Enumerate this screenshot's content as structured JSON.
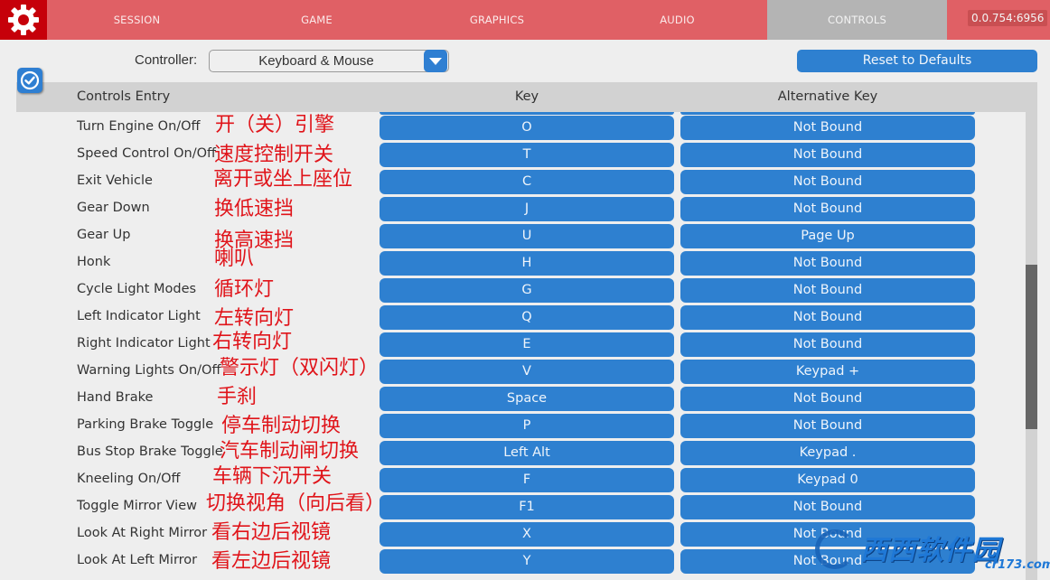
{
  "topbar": {
    "tabs": [
      {
        "label": "SESSION",
        "active": false
      },
      {
        "label": "GAME",
        "active": false
      },
      {
        "label": "GRAPHICS",
        "active": false
      },
      {
        "label": "AUDIO",
        "active": false
      },
      {
        "label": "CONTROLS",
        "active": true
      }
    ],
    "version": "0.0.754:6956",
    "settings_icon": "gear-icon"
  },
  "controller": {
    "label": "Controller:",
    "selected": "Keyboard & Mouse"
  },
  "reset_button": "Reset to Defaults",
  "table": {
    "headers": {
      "entry": "Controls Entry",
      "key": "Key",
      "alt_key": "Alternative Key"
    },
    "rows": [
      {
        "entry": "Turn Engine On/Off",
        "note": "开（关）引擎",
        "key": "O",
        "alt": "Not Bound"
      },
      {
        "entry": "Speed Control On/Off",
        "note": "速度控制开关",
        "key": "T",
        "alt": "Not Bound"
      },
      {
        "entry": "Exit Vehicle",
        "note": "离开或坐上座位",
        "key": "C",
        "alt": "Not Bound"
      },
      {
        "entry": "Gear Down",
        "note": "换低速挡",
        "key": "J",
        "alt": "Not Bound"
      },
      {
        "entry": "Gear Up",
        "note": "换高速挡",
        "key": "U",
        "alt": "Page Up"
      },
      {
        "entry": "Honk",
        "note": "喇叭",
        "key": "H",
        "alt": "Not Bound"
      },
      {
        "entry": "Cycle Light Modes",
        "note": "循环灯",
        "key": "G",
        "alt": "Not Bound"
      },
      {
        "entry": "Left Indicator Light",
        "note": "左转向灯",
        "key": "Q",
        "alt": "Not Bound"
      },
      {
        "entry": "Right Indicator Light",
        "note": "右转向灯",
        "key": "E",
        "alt": "Not Bound"
      },
      {
        "entry": "Warning Lights On/Off",
        "note": "警示灯（双闪灯）",
        "key": "V",
        "alt": "Keypad +"
      },
      {
        "entry": "Hand Brake",
        "note": "手刹",
        "key": "Space",
        "alt": "Not Bound"
      },
      {
        "entry": "Parking Brake Toggle",
        "note": "停车制动切换",
        "key": "P",
        "alt": "Not Bound"
      },
      {
        "entry": "Bus Stop Brake Toggle",
        "note": "汽车制动闸切换",
        "key": "Left Alt",
        "alt": "Keypad ."
      },
      {
        "entry": "Kneeling On/Off",
        "note": "车辆下沉开关",
        "key": "F",
        "alt": "Keypad 0"
      },
      {
        "entry": "Toggle Mirror View",
        "note": "切换视角（向后看）",
        "key": "F1",
        "alt": "Not Bound"
      },
      {
        "entry": "Look At Right Mirror",
        "note": "看右边后视镜",
        "key": "X",
        "alt": "Not Bound"
      },
      {
        "entry": "Look At Left Mirror",
        "note": "看左边后视镜",
        "key": "Y",
        "alt": "Not Bound"
      }
    ]
  },
  "watermark": {
    "text": "西西软件园",
    "sub": "cr173.com"
  },
  "colors": {
    "topbar": "#e06065",
    "gear_block": "#c6000a",
    "active_tab": "#b4b4b4",
    "button_blue": "#2e80d0",
    "annotation_red": "#e0141a"
  }
}
